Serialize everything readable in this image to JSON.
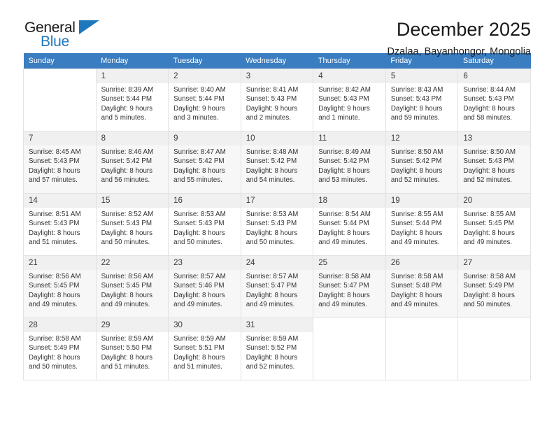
{
  "logo": {
    "word_top": "General",
    "word_bottom": "Blue",
    "accent_color": "#1f77bc"
  },
  "header": {
    "title": "December 2025",
    "subtitle": "Dzalaa, Bayanhongor, Mongolia"
  },
  "calendar": {
    "header_bg": "#3a7dc0",
    "weekdays": [
      "Sunday",
      "Monday",
      "Tuesday",
      "Wednesday",
      "Thursday",
      "Friday",
      "Saturday"
    ],
    "weeks": [
      [
        {
          "day": "",
          "lines": []
        },
        {
          "day": "1",
          "lines": [
            "Sunrise: 8:39 AM",
            "Sunset: 5:44 PM",
            "Daylight: 9 hours",
            "and 5 minutes."
          ]
        },
        {
          "day": "2",
          "lines": [
            "Sunrise: 8:40 AM",
            "Sunset: 5:44 PM",
            "Daylight: 9 hours",
            "and 3 minutes."
          ]
        },
        {
          "day": "3",
          "lines": [
            "Sunrise: 8:41 AM",
            "Sunset: 5:43 PM",
            "Daylight: 9 hours",
            "and 2 minutes."
          ]
        },
        {
          "day": "4",
          "lines": [
            "Sunrise: 8:42 AM",
            "Sunset: 5:43 PM",
            "Daylight: 9 hours",
            "and 1 minute."
          ]
        },
        {
          "day": "5",
          "lines": [
            "Sunrise: 8:43 AM",
            "Sunset: 5:43 PM",
            "Daylight: 8 hours",
            "and 59 minutes."
          ]
        },
        {
          "day": "6",
          "lines": [
            "Sunrise: 8:44 AM",
            "Sunset: 5:43 PM",
            "Daylight: 8 hours",
            "and 58 minutes."
          ]
        }
      ],
      [
        {
          "day": "7",
          "lines": [
            "Sunrise: 8:45 AM",
            "Sunset: 5:43 PM",
            "Daylight: 8 hours",
            "and 57 minutes."
          ]
        },
        {
          "day": "8",
          "lines": [
            "Sunrise: 8:46 AM",
            "Sunset: 5:42 PM",
            "Daylight: 8 hours",
            "and 56 minutes."
          ]
        },
        {
          "day": "9",
          "lines": [
            "Sunrise: 8:47 AM",
            "Sunset: 5:42 PM",
            "Daylight: 8 hours",
            "and 55 minutes."
          ]
        },
        {
          "day": "10",
          "lines": [
            "Sunrise: 8:48 AM",
            "Sunset: 5:42 PM",
            "Daylight: 8 hours",
            "and 54 minutes."
          ]
        },
        {
          "day": "11",
          "lines": [
            "Sunrise: 8:49 AM",
            "Sunset: 5:42 PM",
            "Daylight: 8 hours",
            "and 53 minutes."
          ]
        },
        {
          "day": "12",
          "lines": [
            "Sunrise: 8:50 AM",
            "Sunset: 5:42 PM",
            "Daylight: 8 hours",
            "and 52 minutes."
          ]
        },
        {
          "day": "13",
          "lines": [
            "Sunrise: 8:50 AM",
            "Sunset: 5:43 PM",
            "Daylight: 8 hours",
            "and 52 minutes."
          ]
        }
      ],
      [
        {
          "day": "14",
          "lines": [
            "Sunrise: 8:51 AM",
            "Sunset: 5:43 PM",
            "Daylight: 8 hours",
            "and 51 minutes."
          ]
        },
        {
          "day": "15",
          "lines": [
            "Sunrise: 8:52 AM",
            "Sunset: 5:43 PM",
            "Daylight: 8 hours",
            "and 50 minutes."
          ]
        },
        {
          "day": "16",
          "lines": [
            "Sunrise: 8:53 AM",
            "Sunset: 5:43 PM",
            "Daylight: 8 hours",
            "and 50 minutes."
          ]
        },
        {
          "day": "17",
          "lines": [
            "Sunrise: 8:53 AM",
            "Sunset: 5:43 PM",
            "Daylight: 8 hours",
            "and 50 minutes."
          ]
        },
        {
          "day": "18",
          "lines": [
            "Sunrise: 8:54 AM",
            "Sunset: 5:44 PM",
            "Daylight: 8 hours",
            "and 49 minutes."
          ]
        },
        {
          "day": "19",
          "lines": [
            "Sunrise: 8:55 AM",
            "Sunset: 5:44 PM",
            "Daylight: 8 hours",
            "and 49 minutes."
          ]
        },
        {
          "day": "20",
          "lines": [
            "Sunrise: 8:55 AM",
            "Sunset: 5:45 PM",
            "Daylight: 8 hours",
            "and 49 minutes."
          ]
        }
      ],
      [
        {
          "day": "21",
          "lines": [
            "Sunrise: 8:56 AM",
            "Sunset: 5:45 PM",
            "Daylight: 8 hours",
            "and 49 minutes."
          ]
        },
        {
          "day": "22",
          "lines": [
            "Sunrise: 8:56 AM",
            "Sunset: 5:45 PM",
            "Daylight: 8 hours",
            "and 49 minutes."
          ]
        },
        {
          "day": "23",
          "lines": [
            "Sunrise: 8:57 AM",
            "Sunset: 5:46 PM",
            "Daylight: 8 hours",
            "and 49 minutes."
          ]
        },
        {
          "day": "24",
          "lines": [
            "Sunrise: 8:57 AM",
            "Sunset: 5:47 PM",
            "Daylight: 8 hours",
            "and 49 minutes."
          ]
        },
        {
          "day": "25",
          "lines": [
            "Sunrise: 8:58 AM",
            "Sunset: 5:47 PM",
            "Daylight: 8 hours",
            "and 49 minutes."
          ]
        },
        {
          "day": "26",
          "lines": [
            "Sunrise: 8:58 AM",
            "Sunset: 5:48 PM",
            "Daylight: 8 hours",
            "and 49 minutes."
          ]
        },
        {
          "day": "27",
          "lines": [
            "Sunrise: 8:58 AM",
            "Sunset: 5:49 PM",
            "Daylight: 8 hours",
            "and 50 minutes."
          ]
        }
      ],
      [
        {
          "day": "28",
          "lines": [
            "Sunrise: 8:58 AM",
            "Sunset: 5:49 PM",
            "Daylight: 8 hours",
            "and 50 minutes."
          ]
        },
        {
          "day": "29",
          "lines": [
            "Sunrise: 8:59 AM",
            "Sunset: 5:50 PM",
            "Daylight: 8 hours",
            "and 51 minutes."
          ]
        },
        {
          "day": "30",
          "lines": [
            "Sunrise: 8:59 AM",
            "Sunset: 5:51 PM",
            "Daylight: 8 hours",
            "and 51 minutes."
          ]
        },
        {
          "day": "31",
          "lines": [
            "Sunrise: 8:59 AM",
            "Sunset: 5:52 PM",
            "Daylight: 8 hours",
            "and 52 minutes."
          ]
        },
        {
          "day": "",
          "lines": []
        },
        {
          "day": "",
          "lines": []
        },
        {
          "day": "",
          "lines": []
        }
      ]
    ]
  }
}
